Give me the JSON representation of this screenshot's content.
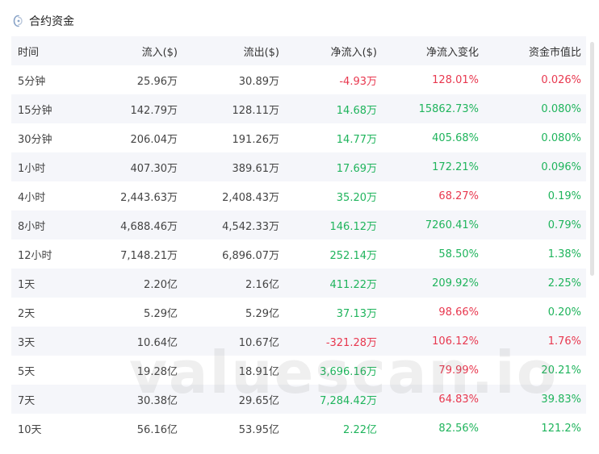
{
  "header": {
    "title": "合约资金",
    "icon": "coin-icon"
  },
  "table": {
    "columns": [
      "时间",
      "流入($)",
      "流出($)",
      "净流入($)",
      "净流入变化",
      "资金市值比"
    ],
    "rows": [
      {
        "time": "5分钟",
        "inflow": "25.96万",
        "outflow": "30.89万",
        "net": "-4.93万",
        "change": "128.01%",
        "ratio": "0.026%",
        "net_color": "neg",
        "change_color": "neg",
        "ratio_color": "neg"
      },
      {
        "time": "15分钟",
        "inflow": "142.79万",
        "outflow": "128.11万",
        "net": "14.68万",
        "change": "15862.73%",
        "ratio": "0.080%",
        "net_color": "pos",
        "change_color": "pos",
        "ratio_color": "pos"
      },
      {
        "time": "30分钟",
        "inflow": "206.04万",
        "outflow": "191.26万",
        "net": "14.77万",
        "change": "405.68%",
        "ratio": "0.080%",
        "net_color": "pos",
        "change_color": "pos",
        "ratio_color": "pos"
      },
      {
        "time": "1小时",
        "inflow": "407.30万",
        "outflow": "389.61万",
        "net": "17.69万",
        "change": "172.21%",
        "ratio": "0.096%",
        "net_color": "pos",
        "change_color": "pos",
        "ratio_color": "pos"
      },
      {
        "time": "4小时",
        "inflow": "2,443.63万",
        "outflow": "2,408.43万",
        "net": "35.20万",
        "change": "68.27%",
        "ratio": "0.19%",
        "net_color": "pos",
        "change_color": "neg",
        "ratio_color": "pos"
      },
      {
        "time": "8小时",
        "inflow": "4,688.46万",
        "outflow": "4,542.33万",
        "net": "146.12万",
        "change": "7260.41%",
        "ratio": "0.79%",
        "net_color": "pos",
        "change_color": "pos",
        "ratio_color": "pos"
      },
      {
        "time": "12小时",
        "inflow": "7,148.21万",
        "outflow": "6,896.07万",
        "net": "252.14万",
        "change": "58.50%",
        "ratio": "1.38%",
        "net_color": "pos",
        "change_color": "pos",
        "ratio_color": "pos"
      },
      {
        "time": "1天",
        "inflow": "2.20亿",
        "outflow": "2.16亿",
        "net": "411.22万",
        "change": "209.92%",
        "ratio": "2.25%",
        "net_color": "pos",
        "change_color": "pos",
        "ratio_color": "pos"
      },
      {
        "time": "2天",
        "inflow": "5.29亿",
        "outflow": "5.29亿",
        "net": "37.13万",
        "change": "98.66%",
        "ratio": "0.20%",
        "net_color": "pos",
        "change_color": "neg",
        "ratio_color": "pos"
      },
      {
        "time": "3天",
        "inflow": "10.64亿",
        "outflow": "10.67亿",
        "net": "-321.28万",
        "change": "106.12%",
        "ratio": "1.76%",
        "net_color": "neg",
        "change_color": "neg",
        "ratio_color": "neg"
      },
      {
        "time": "5天",
        "inflow": "19.28亿",
        "outflow": "18.91亿",
        "net": "3,696.16万",
        "change": "79.99%",
        "ratio": "20.21%",
        "net_color": "pos",
        "change_color": "neg",
        "ratio_color": "pos"
      },
      {
        "time": "7天",
        "inflow": "30.38亿",
        "outflow": "29.65亿",
        "net": "7,284.42万",
        "change": "64.83%",
        "ratio": "39.83%",
        "net_color": "pos",
        "change_color": "neg",
        "ratio_color": "pos"
      },
      {
        "time": "10天",
        "inflow": "56.16亿",
        "outflow": "53.95亿",
        "net": "2.22亿",
        "change": "82.56%",
        "ratio": "121.2%",
        "net_color": "pos",
        "change_color": "pos",
        "ratio_color": "pos"
      }
    ]
  },
  "watermark": "valuescan.io",
  "colors": {
    "negative": "#e8384f",
    "positive": "#1fb45c",
    "stripe": "#f5f6fa"
  }
}
